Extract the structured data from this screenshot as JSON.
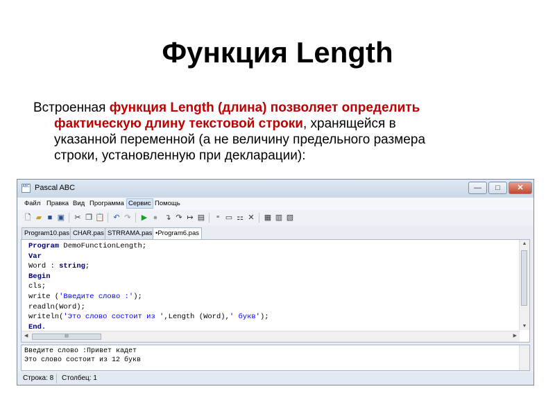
{
  "slide": {
    "title": "Функция Length",
    "text": {
      "part1": "Встроенная ",
      "highlight_line1": "функция Length (длина) позволяет определить",
      "highlight_line2": "фактическую длину текстовой строки",
      "line2_rest": ", хранящейся в",
      "line3": "указанной переменной (а не величину предельного размера",
      "line4": "строки, установленную при декларации):"
    }
  },
  "window": {
    "title": "Pascal ABC",
    "app_icon_text": "ABC",
    "controls": {
      "minimize": "—",
      "maximize": "□",
      "close": "✕"
    },
    "menu": [
      "Файл",
      "Правка",
      "Вид",
      "Программа",
      "Сервис",
      "Помощь"
    ],
    "active_menu": "Сервис",
    "toolbar_icons": [
      "new-file-icon",
      "open-folder-icon",
      "save-icon",
      "save-all-icon",
      "cut-icon",
      "copy-icon",
      "paste-icon",
      "undo-icon",
      "redo-icon",
      "run-icon",
      "stop-icon",
      "step-into-icon",
      "step-over-icon",
      "run-to-cursor-icon",
      "watch-icon",
      "close-icon",
      "window-icon-1",
      "window-icon-2",
      "window-icon-3"
    ],
    "tabs": [
      "Program10.pas",
      "CHAR.pas",
      "STRRAMA.pas",
      "•Program6.pas"
    ],
    "active_tab": 3,
    "code": {
      "l1_kw": "Program",
      "l1_rest": " DemoFunctionLength;",
      "l2_kw": "Var",
      "l3_a": "Word : ",
      "l3_kw": "string",
      "l3_b": ";",
      "l4_kw": "Begin",
      "l5": "cls;",
      "l6_a": "write (",
      "l6_str": "'Введите слово :'",
      "l6_b": ");",
      "l7": "readln(Word);",
      "l8_a": "writeln(",
      "l8_str1": "'Это слово состоит из '",
      "l8_b": ",Length (Word),",
      "l8_str2": "' букв'",
      "l8_c": ");",
      "l9_kw": "End",
      "l9_b": "."
    },
    "hscroll_thumb": "III",
    "output": {
      "line1": "Введите слово :Привет кадет",
      "line2": "Это слово состоит из 12 букв"
    },
    "status": {
      "line": "Строка: 8",
      "column": "Столбец: 1"
    }
  }
}
